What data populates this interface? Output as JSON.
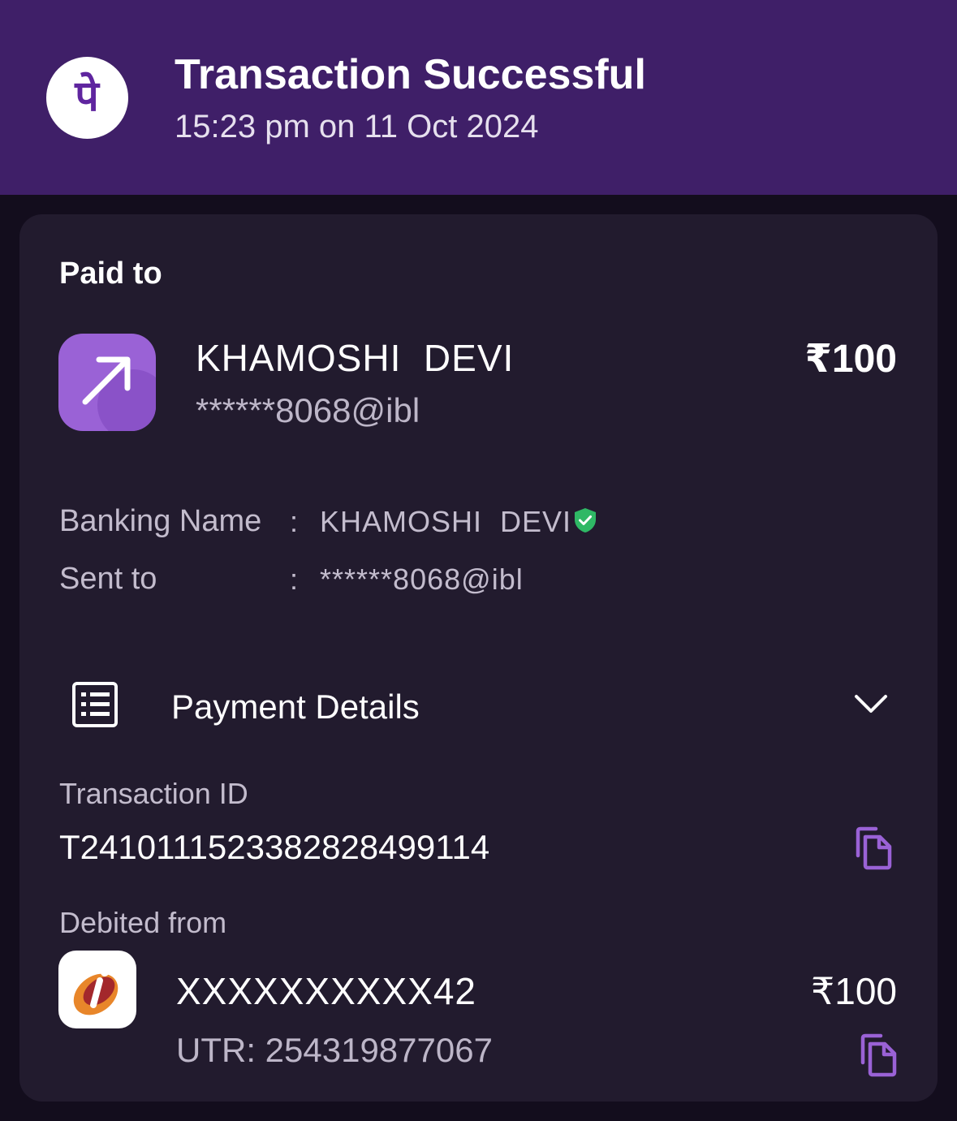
{
  "header": {
    "title": "Transaction Successful",
    "timestamp": "15:23 pm on 11 Oct 2024",
    "logo_glyph": "पे",
    "logo_icon": "phonepe-logo-icon",
    "background_color": "#3f1f68"
  },
  "paid_to": {
    "label": "Paid to",
    "icon": "arrow-up-right-icon",
    "name": "KHAMOSHI  DEVI",
    "vpa": "******8068@ibl",
    "amount": "₹100"
  },
  "details": {
    "banking_name_label": "Banking Name",
    "banking_name_value": "KHAMOSHI  DEVI",
    "verified_icon": "verified-shield-icon",
    "sent_to_label": "Sent to",
    "sent_to_value": "******8068@ibl",
    "separator": ":"
  },
  "payment_details": {
    "title": "Payment Details",
    "icon": "receipt-list-icon",
    "toggle_icon": "chevron-down-icon",
    "transaction_id_label": "Transaction ID",
    "transaction_id": "T2410111523382828499114",
    "debited_from_label": "Debited from",
    "bank_icon": "icici-bank-logo",
    "account_number": "XXXXXXXXXX42",
    "utr": "UTR: 254319877067",
    "debit_amount": "₹100"
  },
  "colors": {
    "accent": "#9a62d6",
    "verified": "#2fb865",
    "card_background": "#221b2e"
  }
}
